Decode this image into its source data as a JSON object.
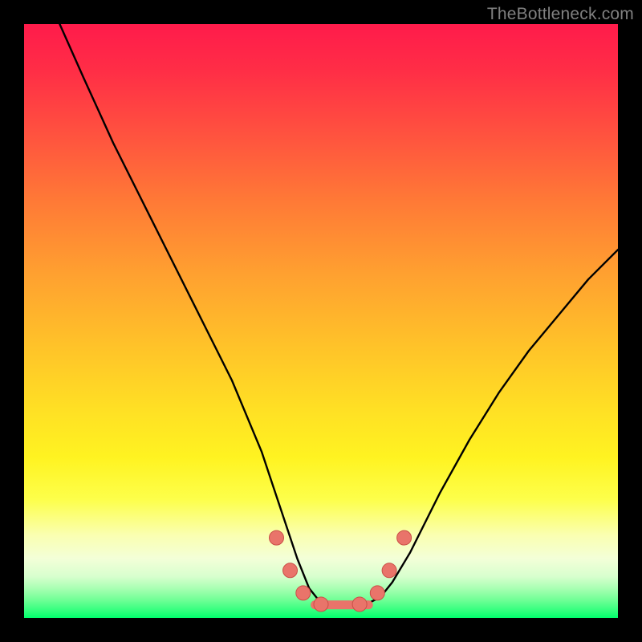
{
  "watermark": "TheBottleneck.com",
  "chart_data": {
    "type": "line",
    "title": "",
    "xlabel": "",
    "ylabel": "",
    "xlim": [
      0,
      100
    ],
    "ylim": [
      0,
      100
    ],
    "grid": false,
    "legend": false,
    "series": [
      {
        "name": "bottleneck-curve",
        "x": [
          6,
          10,
          15,
          20,
          25,
          30,
          35,
          40,
          42,
          44,
          46,
          48,
          50,
          52,
          54,
          56,
          58,
          60,
          62,
          65,
          70,
          75,
          80,
          85,
          90,
          95,
          100
        ],
        "y": [
          100,
          91,
          80,
          70,
          60,
          50,
          40,
          28,
          22,
          16,
          10,
          5,
          2.5,
          2,
          2,
          2,
          2.5,
          3.5,
          6,
          11,
          21,
          30,
          38,
          45,
          51,
          57,
          62
        ]
      }
    ],
    "markers": [
      {
        "name": "marker-left-upper",
        "x": 42.5,
        "y": 13.5
      },
      {
        "name": "marker-left-mid",
        "x": 44.8,
        "y": 8.0
      },
      {
        "name": "marker-left-lower",
        "x": 47.0,
        "y": 4.2
      },
      {
        "name": "marker-trough-l",
        "x": 50.0,
        "y": 2.3
      },
      {
        "name": "marker-trough-r",
        "x": 56.5,
        "y": 2.3
      },
      {
        "name": "marker-right-lower",
        "x": 59.5,
        "y": 4.2
      },
      {
        "name": "marker-right-mid",
        "x": 61.5,
        "y": 8.0
      },
      {
        "name": "marker-right-upper",
        "x": 64.0,
        "y": 13.5
      }
    ],
    "trough_segment": {
      "x0": 49,
      "x1": 58,
      "y": 2.2
    },
    "marker_style": {
      "fill": "#e9746a",
      "stroke": "#c94f47",
      "r": 9
    },
    "line_style": {
      "stroke": "#000000",
      "width": 2.4
    }
  }
}
